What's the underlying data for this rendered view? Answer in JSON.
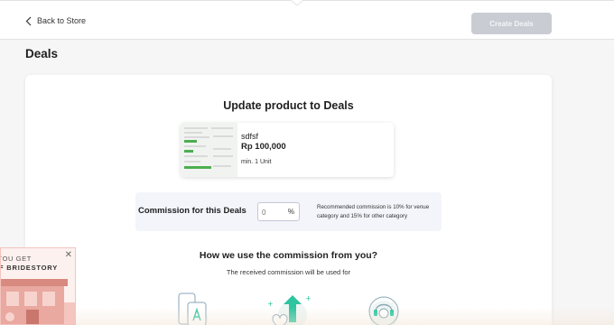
{
  "header": {
    "back_label": "Back to Store",
    "create_button_label": "Create Deals"
  },
  "page": {
    "title": "Deals"
  },
  "card": {
    "title": "Update product to Deals",
    "product": {
      "name": "sdfsf",
      "price": "Rp 100,000",
      "min_order": "min. 1 Unit"
    },
    "commission": {
      "label": "Commission for this Deals",
      "placeholder": "0",
      "unit": "%",
      "note": "Recommended commission is 10% for venue category and 15% for other category"
    },
    "usage": {
      "title": "How we use the commission from you?",
      "subtitle": "The received commission will be used for"
    }
  },
  "promo": {
    "line1": "YOU GET",
    "line2": "F BRIDESTORY"
  },
  "colors": {
    "button_disabled": "#c9ccd3",
    "accent_green": "#2ec4a0",
    "commission_bg": "#f3f5fb"
  }
}
